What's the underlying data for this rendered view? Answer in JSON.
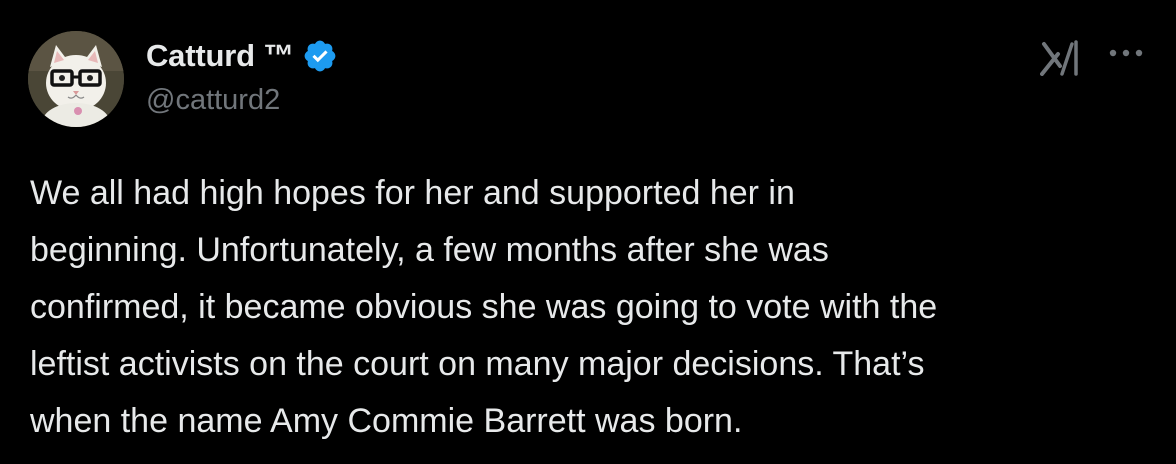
{
  "author": {
    "display_name": "Catturd ™",
    "handle": "@catturd2",
    "verified": true,
    "avatar": "cat-with-glasses-avatar"
  },
  "header_icons": [
    "xai-logo-icon",
    "more-options-icon"
  ],
  "tweet": {
    "lines": [
      "We all had high hopes for her and supported her in",
      "beginning. Unfortunately, a few months after she was",
      "confirmed, it became obvious she was going to vote with the",
      "leftist activists on the court on many major decisions. That’s",
      "when the name Amy Commie Barrett was born."
    ]
  },
  "colors": {
    "background": "#000000",
    "text": "#e7e9ea",
    "secondary_text": "#71767b",
    "verified_badge": "#1d9bf0"
  }
}
